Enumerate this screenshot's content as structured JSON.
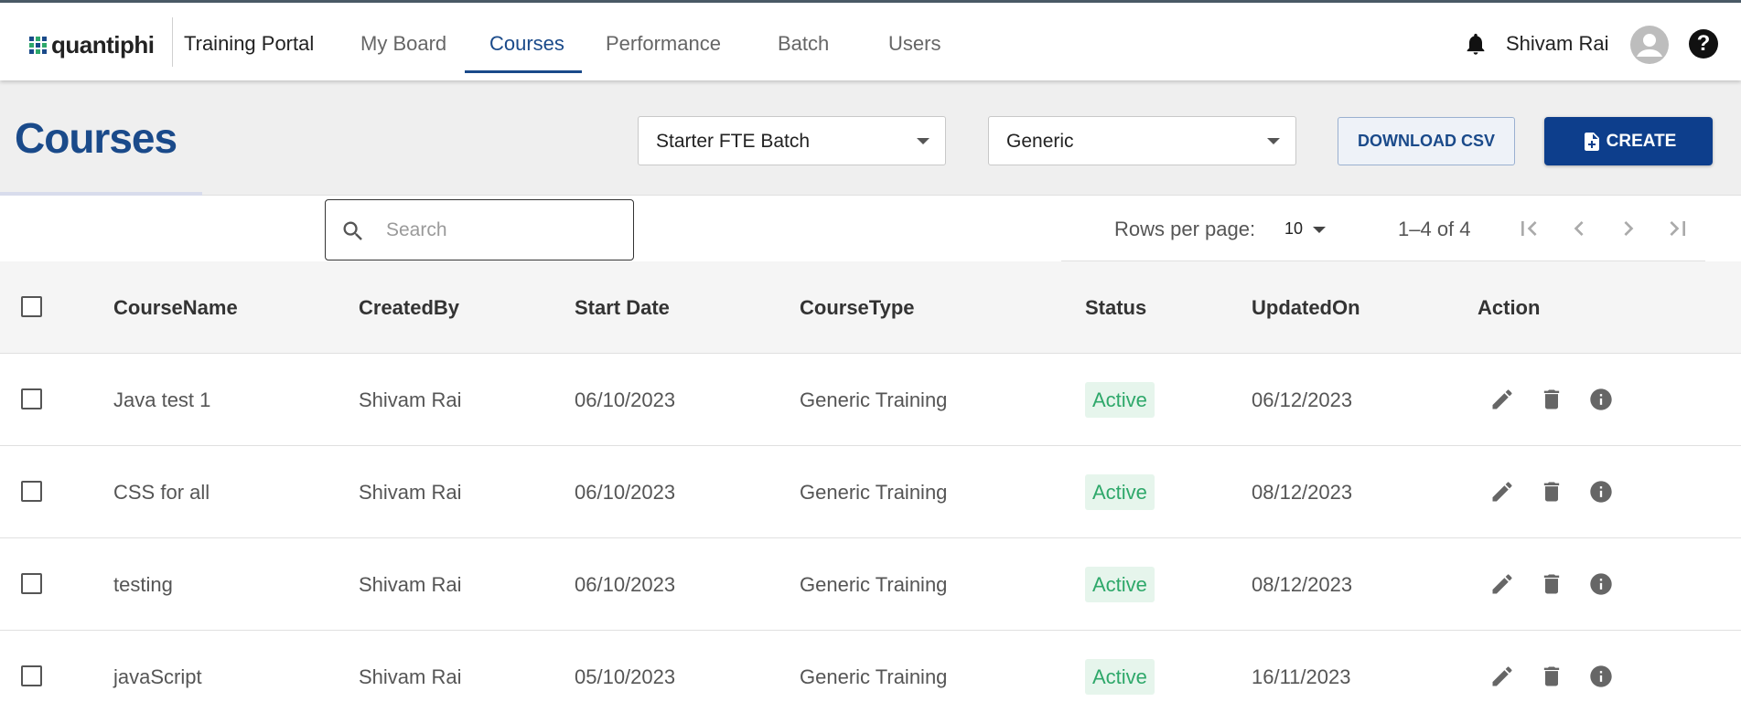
{
  "brand": {
    "logo_text": "quantiphi",
    "app_name": "Training Portal",
    "colors": {
      "primary": "#1a4a8a",
      "create_button": "#0d3e8c",
      "active_badge_bg": "#e6f5ec",
      "active_badge_text": "#2ea86a"
    }
  },
  "nav": {
    "items": [
      {
        "label": "My Board",
        "active": false
      },
      {
        "label": "Courses",
        "active": true
      },
      {
        "label": "Performance",
        "active": false
      },
      {
        "label": "Batch",
        "active": false
      },
      {
        "label": "Users",
        "active": false
      }
    ],
    "user_name": "Shivam Rai",
    "icons": [
      "bell-icon",
      "account-circle-icon",
      "help-icon"
    ]
  },
  "page": {
    "title": "Courses",
    "batch_select": {
      "value": "Starter FTE Batch"
    },
    "type_select": {
      "value": "Generic"
    },
    "download_label": "DOWNLOAD CSV",
    "create_label": "CREATE"
  },
  "search": {
    "placeholder": "Search",
    "value": ""
  },
  "pagination": {
    "rows_per_page_label": "Rows per page:",
    "rows_per_page": "10",
    "range": "1–4 of 4",
    "icons": [
      "first-page-icon",
      "prev-page-icon",
      "next-page-icon",
      "last-page-icon"
    ]
  },
  "table": {
    "columns": [
      "CourseName",
      "CreatedBy",
      "Start Date",
      "CourseType",
      "Status",
      "UpdatedOn",
      "Action"
    ],
    "rows": [
      {
        "name": "Java test 1",
        "created_by": "Shivam Rai",
        "start_date": "06/10/2023",
        "type": "Generic Training",
        "status": "Active",
        "updated_on": "06/12/2023"
      },
      {
        "name": "CSS for all",
        "created_by": "Shivam Rai",
        "start_date": "06/10/2023",
        "type": "Generic Training",
        "status": "Active",
        "updated_on": "08/12/2023"
      },
      {
        "name": "testing",
        "created_by": "Shivam Rai",
        "start_date": "06/10/2023",
        "type": "Generic Training",
        "status": "Active",
        "updated_on": "08/12/2023"
      },
      {
        "name": "javaScript",
        "created_by": "Shivam Rai",
        "start_date": "05/10/2023",
        "type": "Generic Training",
        "status": "Active",
        "updated_on": "16/11/2023"
      }
    ],
    "row_action_icons": [
      "edit-icon",
      "delete-icon",
      "info-icon"
    ]
  }
}
